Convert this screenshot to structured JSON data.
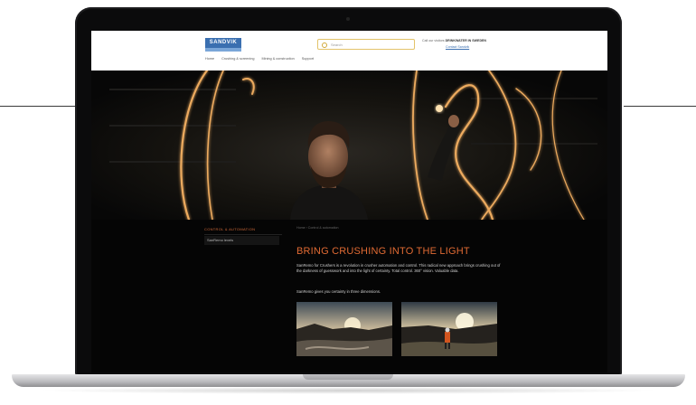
{
  "website": {
    "logo_text": "SANDVIK",
    "search": {
      "placeholder": "Search"
    },
    "contact_line_prefix": "Call our visitors",
    "contact_line_bold": "DRINKWATER IN SWEDEN",
    "contact_link": "Contact Sandvik",
    "nav": [
      "Home",
      "Crushing & screening",
      "Mining & construction",
      "Support"
    ],
    "sidebar": {
      "title": "CONTROL & AUTOMATION",
      "items": [
        "SanRemo levels"
      ]
    },
    "breadcrumb": "Home  ›  Control & automation",
    "headline": "BRING CRUSHING INTO THE LIGHT",
    "paragraph_1": "SanRemo for Crushers is a revolution in crusher automation and control. This radical new approach brings crushing out of the darkness of guesswork and into the light of certainty. Total control. 360° vision. Valuable data.",
    "paragraph_2": "SanRemo gives you certainty in three dimensions."
  },
  "colors": {
    "accent": "#e06a33",
    "brand": "#3a6fb0",
    "search_border": "#e3c36a",
    "light_trail": "#ffb866"
  },
  "icons": [
    "search-icon",
    "camera-icon"
  ]
}
